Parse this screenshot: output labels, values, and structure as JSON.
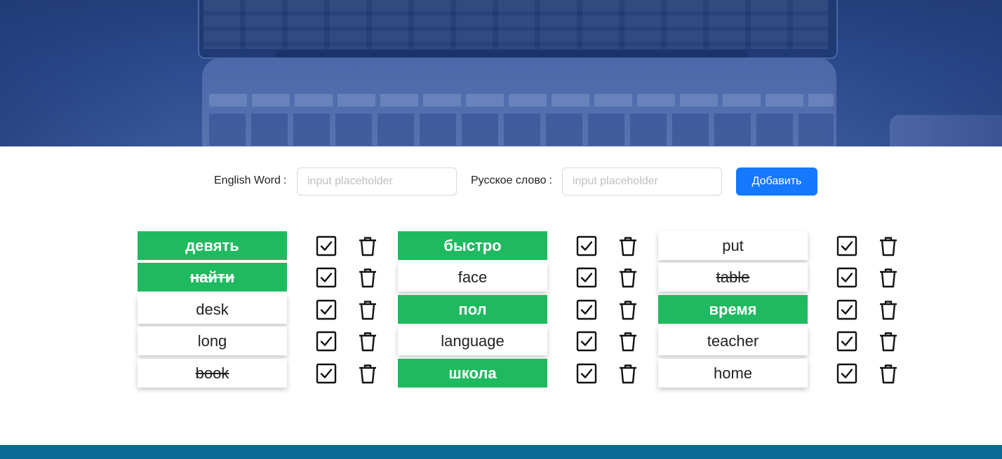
{
  "form": {
    "english_label": "English Word",
    "english_placeholder": "input placeholder",
    "english_value": "",
    "russian_label": "Русское слово",
    "russian_placeholder": "input placeholder",
    "russian_value": "",
    "add_button_label": "Добавить"
  },
  "colors": {
    "learned": "#1fba5f",
    "button": "#1677ff",
    "footer": "#0a6a93"
  },
  "icons": {
    "check": "checkbox-checked-icon",
    "delete": "trash-icon"
  },
  "words": [
    {
      "text": "девять",
      "learned": true,
      "struck": false
    },
    {
      "text": "найти",
      "learned": true,
      "struck": true
    },
    {
      "text": "desk",
      "learned": false,
      "struck": false
    },
    {
      "text": "long",
      "learned": false,
      "struck": false
    },
    {
      "text": "book",
      "learned": false,
      "struck": true
    },
    {
      "text": "быстро",
      "learned": true,
      "struck": false
    },
    {
      "text": "face",
      "learned": false,
      "struck": false
    },
    {
      "text": "пол",
      "learned": true,
      "struck": false
    },
    {
      "text": "language",
      "learned": false,
      "struck": false
    },
    {
      "text": "школа",
      "learned": true,
      "struck": false
    },
    {
      "text": "put",
      "learned": false,
      "struck": false
    },
    {
      "text": "table",
      "learned": false,
      "struck": true
    },
    {
      "text": "время",
      "learned": true,
      "struck": false
    },
    {
      "text": "teacher",
      "learned": false,
      "struck": false
    },
    {
      "text": "home",
      "learned": false,
      "struck": false
    }
  ]
}
